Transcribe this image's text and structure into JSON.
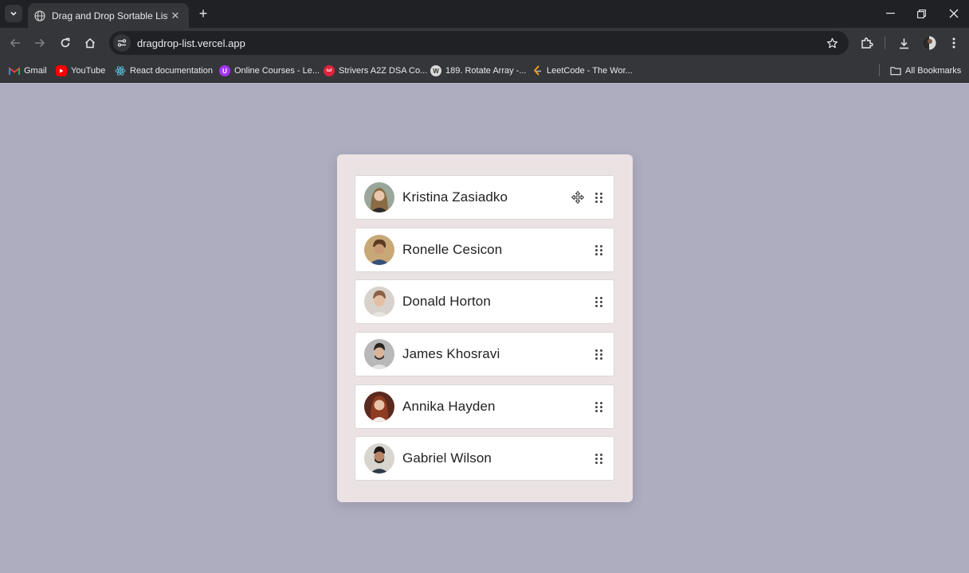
{
  "browser": {
    "tab_title": "Drag and Drop Sortable List",
    "url": "dragdrop-list.vercel.app",
    "bookmarks": [
      {
        "label": "Gmail",
        "icon": "gmail-icon",
        "color": "#ea4335"
      },
      {
        "label": "YouTube",
        "icon": "youtube-icon",
        "color": "#ff0000"
      },
      {
        "label": "React documentation",
        "icon": "react-icon",
        "color": "#58c4dc"
      },
      {
        "label": "Online Courses - Le...",
        "icon": "udemy-icon",
        "color": "#a435f0"
      },
      {
        "label": "Strivers A2Z DSA Co...",
        "icon": "tuf-icon",
        "color": "#e0243c"
      },
      {
        "label": "189. Rotate Array -...",
        "icon": "w-icon",
        "color": "#3c4043"
      },
      {
        "label": "LeetCode - The Wor...",
        "icon": "leetcode-icon",
        "color": "#ffa116"
      }
    ],
    "all_bookmarks": "All Bookmarks"
  },
  "list": {
    "items": [
      {
        "name": "Kristina Zasiadko",
        "avatar": "avatar-photo"
      },
      {
        "name": "Ronelle Cesicon",
        "avatar": "avatar-photo"
      },
      {
        "name": "Donald Horton",
        "avatar": "avatar-photo"
      },
      {
        "name": "James Khosravi",
        "avatar": "avatar-photo"
      },
      {
        "name": "Annika Hayden",
        "avatar": "avatar-photo"
      },
      {
        "name": "Gabriel Wilson",
        "avatar": "avatar-photo"
      }
    ]
  },
  "colors": {
    "page_background": "#aeadbf",
    "card_background": "#ebe3e3",
    "item_background": "#ffffff"
  }
}
